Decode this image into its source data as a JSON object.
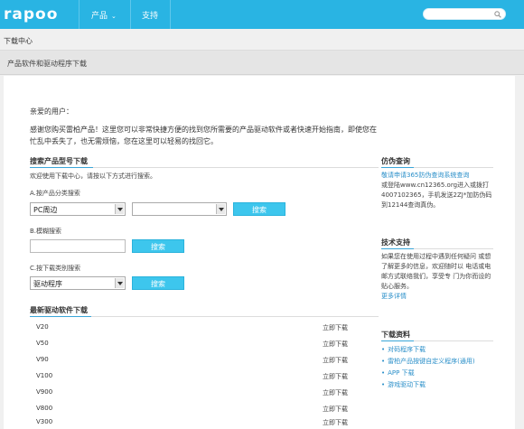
{
  "header": {
    "logo": "rapoo",
    "nav": [
      {
        "label": "产品"
      },
      {
        "label": "支持"
      }
    ],
    "search_placeholder": ""
  },
  "breadcrumb": "下载中心",
  "section_title": "产品软件和驱动程序下载",
  "greeting": "亲爱的用户：",
  "intro": "感谢您购买雷柏产品！这里您可以非常快捷方便的找到您所需要的产品驱动软件或者快速开始指南，即使您在忙乱中丢失了，也无需烦恼，您在这里可以轻易的找回它。",
  "search_section": {
    "title": "搜索产品型号下载",
    "subtitle": "欢迎使用下载中心，请按以下方式进行搜索。",
    "by_category": {
      "label": "A.按产品分类搜索",
      "select1": "PC周边",
      "select2": "",
      "button": "搜索"
    },
    "fuzzy": {
      "label": "B.模糊搜索",
      "input": "",
      "button": "搜索"
    },
    "by_type": {
      "label": "C.按下载类别搜索",
      "select": "驱动程序",
      "button": "搜索"
    }
  },
  "latest": {
    "title": "最新驱动软件下载",
    "action_label": "立即下载",
    "items": [
      "V20",
      "V50",
      "V90",
      "V100",
      "V900",
      "V800",
      "V300"
    ]
  },
  "sidebar": {
    "anti_fake": {
      "title": "仿伪查询",
      "link": "敬请申请365防伪查询系统查询",
      "text": "或登陆www.cn12365.org进入或拨打4007102365，手机发送2ZJ*加防伪码到12144查询真伪。"
    },
    "support": {
      "title": "技术支持",
      "text": "如果您在使用过程中遇到任何疑问 或想了解更多的信息，欢迎随时以 电话或电邮方式联络我们，享受专 门为你而设的贴心服务。",
      "more": "更多详情"
    },
    "downloads": {
      "title": "下载资料",
      "items": [
        "对码程序下载",
        "雷柏产品按键自定义程序(通用)",
        "APP 下载",
        "游戏驱动下载"
      ]
    }
  }
}
